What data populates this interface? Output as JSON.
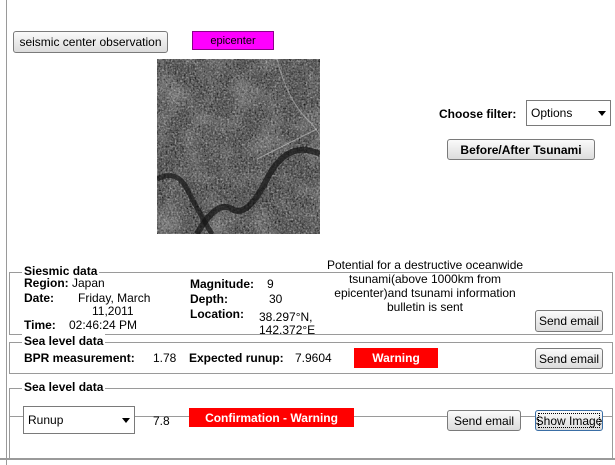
{
  "toolbar": {
    "seismic_button": "seismic center observation",
    "epicenter_button": "epicenter"
  },
  "filter": {
    "label": "Choose filter:",
    "selected": "Options",
    "before_after_button": "Before/After Tsunami"
  },
  "seismic": {
    "legend": "Siesmic data",
    "region_label": "Region:",
    "region": "Japan",
    "date_label": "Date:",
    "date_line1": "Friday, March",
    "date_line2": "11,2011",
    "time_label": "Time:",
    "time": "02:46:24 PM",
    "magnitude_label": "Magnitude:",
    "magnitude": "9",
    "depth_label": "Depth:",
    "depth": "30",
    "location_label": "Location:",
    "location_line1": "38.297°N,",
    "location_line2": "142.372°E",
    "message_line1": "Potential for a destructive oceanwide",
    "message_line2": "tsunami(above 1000km from",
    "message_line3": "epicenter)and tsunami information",
    "message_line4": "bulletin is sent",
    "send_email": "Send email"
  },
  "sea1": {
    "legend": "Sea level data",
    "bpr_label": "BPR measurement:",
    "bpr_value": "1.78",
    "runup_label": "Expected runup:",
    "runup_value": "7.9604",
    "warning": "Warning",
    "send_email": "Send email"
  },
  "sea2": {
    "legend": "Sea level data",
    "select_value": "Runup",
    "value": "7.8",
    "confirmation": "Confirmation - Warning",
    "send_email": "Send email",
    "show_image": "Show Image"
  },
  "colors": {
    "magenta": "#ff00ff",
    "warning_red": "#ff0000"
  }
}
